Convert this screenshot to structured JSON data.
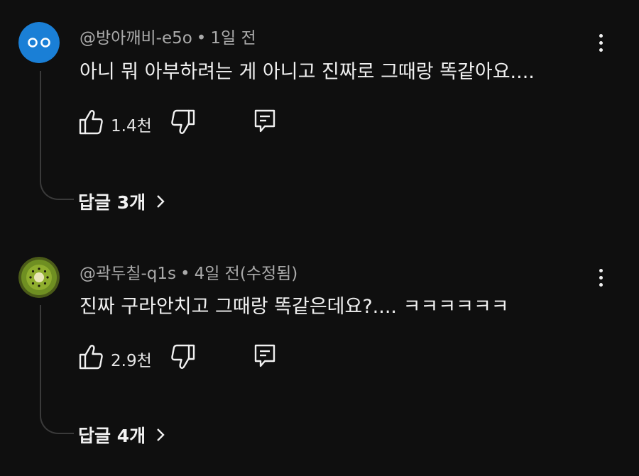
{
  "comments": [
    {
      "author": "@방아깨비-e5o",
      "separator": "•",
      "time": "1일 전",
      "text": "아니 뭐 아부하려는 게 아니고 진짜로 그때랑 똑같아요....",
      "likes": "1.4천",
      "replies_label": "답글 3개",
      "avatar": {
        "icon": "two-dots-face",
        "color": "#1a7fd6"
      }
    },
    {
      "author": "@곽두칠-q1s",
      "separator": "•",
      "time": "4일 전(수정됨)",
      "text": "진짜 구라안치고 그때랑 똑같은데요?.... ㅋㅋㅋㅋㅋㅋ",
      "likes": "2.9천",
      "replies_label": "답글 4개",
      "avatar": {
        "icon": "kiwi-slice",
        "color": "#5f7a1e"
      }
    }
  ]
}
